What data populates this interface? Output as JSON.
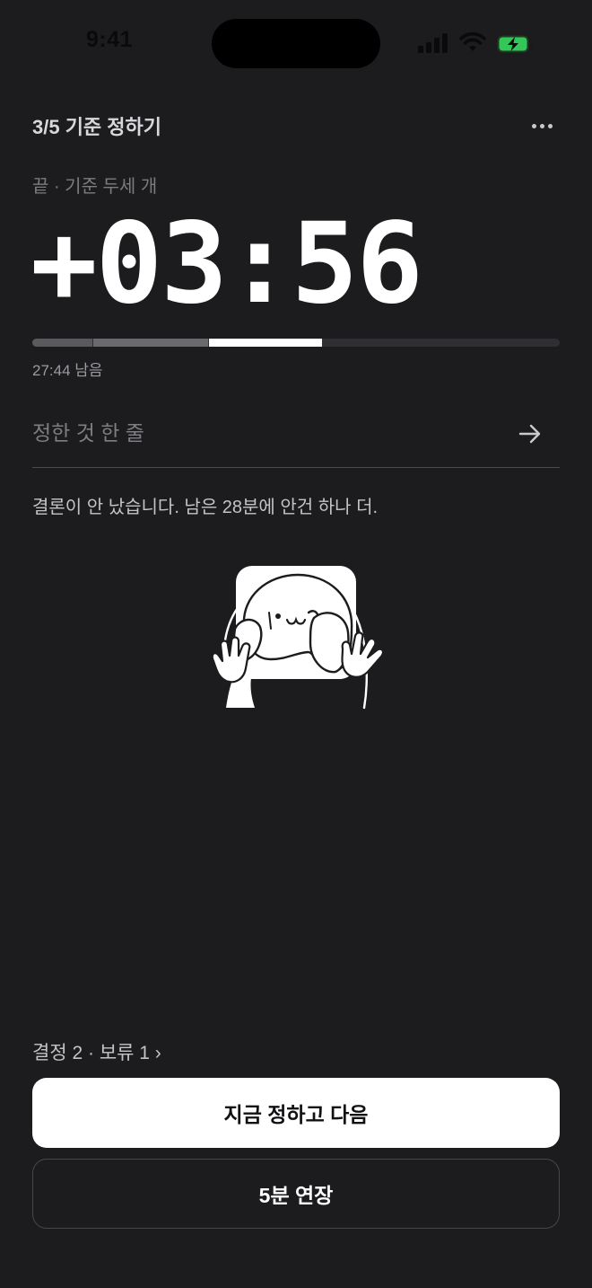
{
  "status_bar": {
    "time": "9:41"
  },
  "header": {
    "step_title": "3/5 기준 정하기",
    "more_icon": "ellipsis-icon"
  },
  "session": {
    "label": "끝 · 기준 두세 개",
    "timer": "+03:56",
    "remaining": "27:44 남음",
    "progress_segments": [
      {
        "fraction": 0.115,
        "color": "#5a5a5e"
      },
      {
        "fraction": 0.22,
        "color": "#6a6a6e"
      },
      {
        "fraction": 0.215,
        "color": "#ffffff"
      }
    ]
  },
  "input": {
    "placeholder": "정한 것 한 줄",
    "value": "",
    "submit_icon": "arrow-right-icon"
  },
  "prompt": "결론이 안 났습니다. 남은 28분에 안건 하나 더.",
  "footer": {
    "tally": "결정 2 · 보류 1 ›",
    "primary_label": "지금 정하고 다음",
    "secondary_label": "5분 연장"
  }
}
